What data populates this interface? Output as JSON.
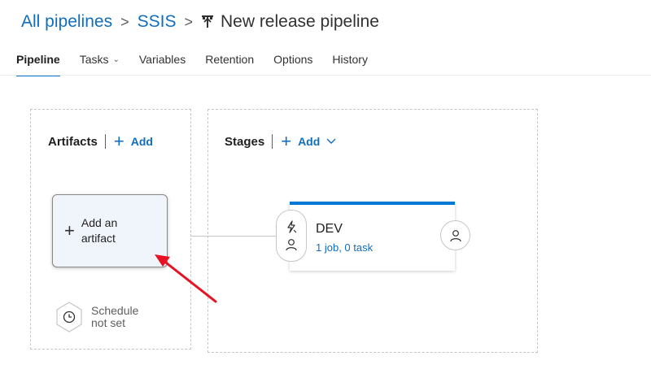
{
  "breadcrumb": {
    "items": [
      "All pipelines",
      "SSIS"
    ],
    "separator": ">",
    "current": "New release pipeline",
    "current_icon": "release-pipeline-icon"
  },
  "tabs": [
    {
      "label": "Pipeline",
      "active": true
    },
    {
      "label": "Tasks",
      "has_dropdown": true
    },
    {
      "label": "Variables"
    },
    {
      "label": "Retention"
    },
    {
      "label": "Options"
    },
    {
      "label": "History"
    }
  ],
  "artifacts": {
    "title": "Artifacts",
    "add_label": "Add",
    "card_plus": "+",
    "card_text": "Add an artifact",
    "schedule_text": "Schedule not set",
    "schedule_icon": "clock-icon"
  },
  "stages": {
    "title": "Stages",
    "add_label": "Add",
    "stage": {
      "name": "DEV",
      "summary": "1 job, 0 task",
      "pre_icons": [
        "lightning-bolt-icon",
        "person-icon"
      ],
      "post_icon": "person-icon"
    }
  },
  "colors": {
    "accent": "#0078d4",
    "link": "#106ebe",
    "annotation": "#e81123",
    "artifact_card_bg": "#eff5fb"
  }
}
